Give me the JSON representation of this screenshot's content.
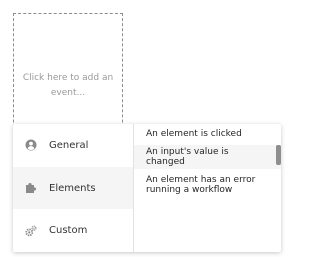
{
  "placeholder": {
    "text": "Click here to add an event..."
  },
  "categories": [
    {
      "label": "General",
      "icon": "user-circle-icon"
    },
    {
      "label": "Elements",
      "icon": "puzzle-piece-icon",
      "active": true
    },
    {
      "label": "Custom",
      "icon": "gears-icon"
    }
  ],
  "events": [
    {
      "label": "An element is clicked"
    },
    {
      "label": "An input's value is changed"
    },
    {
      "label": "An element has an error running a workflow"
    }
  ],
  "colors": {
    "icon": "#8a8a8a",
    "placeholder_border": "#8c8c8c",
    "active_background": "#f5f5f5"
  }
}
